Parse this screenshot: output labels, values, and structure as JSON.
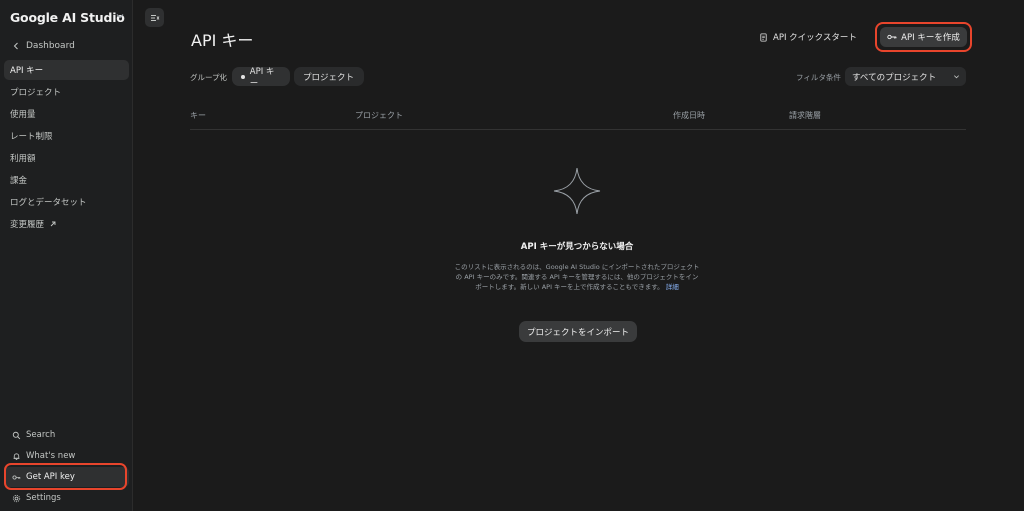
{
  "sidebar": {
    "brand": "Google AI Studio",
    "back_label": "Dashboard",
    "items": [
      {
        "label": "API キー"
      },
      {
        "label": "プロジェクト"
      },
      {
        "label": "使用量"
      },
      {
        "label": "レート制限"
      },
      {
        "label": "利用額"
      },
      {
        "label": "課金"
      },
      {
        "label": "ログとデータセット"
      },
      {
        "label": "変更履歴"
      }
    ],
    "bottom": [
      {
        "label": "Search"
      },
      {
        "label": "What's new"
      },
      {
        "label": "Get API key"
      },
      {
        "label": "Settings"
      }
    ]
  },
  "header": {
    "title": "API キー",
    "quickstart_label": "API クイックスタート",
    "create_label": "API キーを作成"
  },
  "toolbar": {
    "group_label": "グループ化",
    "chip_api": "API キー",
    "chip_project": "プロジェクト",
    "filter_label": "フィルタ条件",
    "filter_value": "すべてのプロジェクト"
  },
  "table": {
    "columns": [
      "キー",
      "プロジェクト",
      "作成日時",
      "請求階層"
    ]
  },
  "empty": {
    "title": "API キーが見つからない場合",
    "description": "このリストに表示されるのは、Google AI Studio にインポートされたプロジェクトの API キーのみです。関連する API キーを管理するには、他のプロジェクトをインポートします。新しい API キーを上で作成することもできます。",
    "link": "詳細",
    "import_label": "プロジェクトをインポート"
  },
  "colors": {
    "accent_highlight": "#e8452c",
    "link": "#8ab4f8"
  }
}
